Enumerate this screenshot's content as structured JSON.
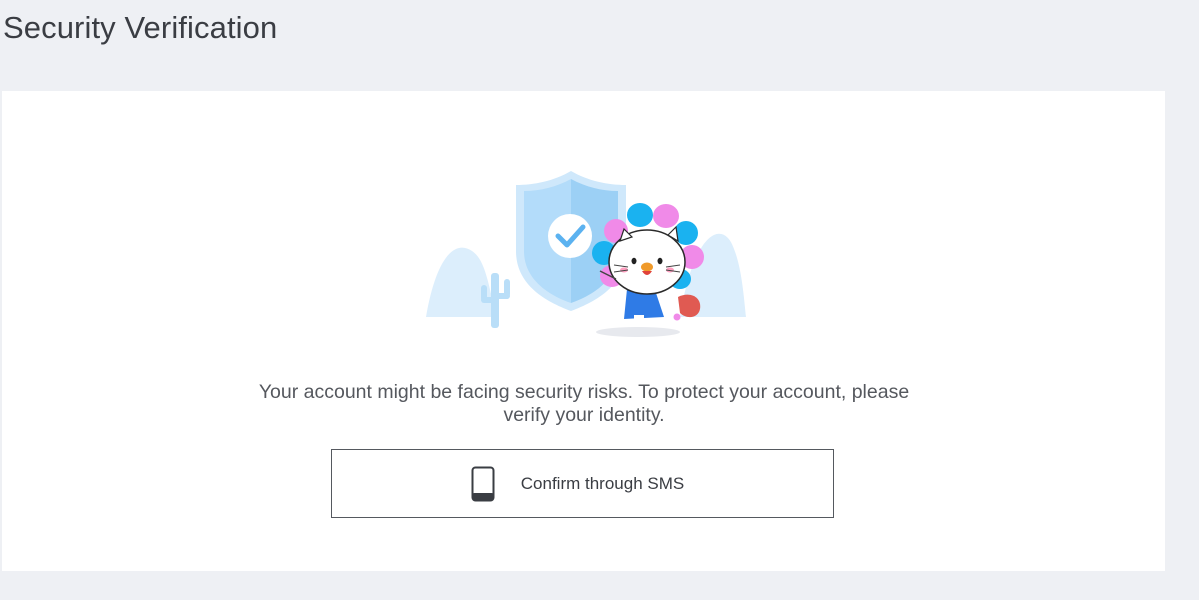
{
  "page": {
    "title": "Security Verification"
  },
  "card": {
    "message": "Your account might be facing security risks. To protect your account, please verify your identity.",
    "illustration": {
      "description_icons": [
        "shield-check-icon",
        "cactus-icon",
        "flower-cat-mascot"
      ]
    }
  },
  "actions": {
    "sms_button_label": "Confirm through SMS",
    "sms_icon": "phone-icon"
  },
  "colors": {
    "background": "#eef0f4",
    "card": "#ffffff",
    "text": "#3a3d43",
    "shield_blue": "#9cd0f5",
    "petal_pink": "#f08ae8",
    "petal_blue": "#1ab2f0",
    "shirt_blue": "#2f7be6"
  }
}
